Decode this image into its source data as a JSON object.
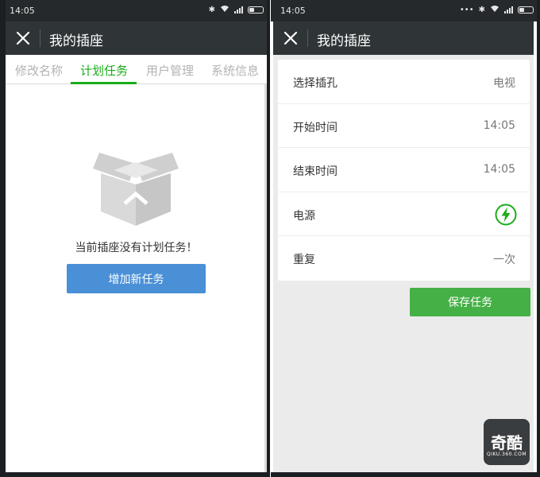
{
  "left": {
    "status": {
      "time": "14:05"
    },
    "header": {
      "title": "我的插座"
    },
    "tabs": [
      {
        "label": "修改名称",
        "active": false
      },
      {
        "label": "计划任务",
        "active": true
      },
      {
        "label": "用户管理",
        "active": false
      },
      {
        "label": "系统信息",
        "active": false
      }
    ],
    "empty": {
      "message": "当前插座没有计划任务！",
      "add_button": "增加新任务"
    }
  },
  "right": {
    "status": {
      "time": "14:05"
    },
    "header": {
      "title": "我的插座"
    },
    "rows": [
      {
        "label": "选择插孔",
        "value": "电视"
      },
      {
        "label": "开始时间",
        "value": "14:05"
      },
      {
        "label": "结束时间",
        "value": "14:05"
      },
      {
        "label": "电源",
        "value": "",
        "icon": "power-on-icon"
      },
      {
        "label": "重复",
        "value": "一次"
      }
    ],
    "save_button": "保存任务",
    "watermark": {
      "main": "奇酷",
      "sub": "QIKU.360.COM"
    }
  },
  "colors": {
    "accent_green": "#1aad19",
    "primary_blue": "#4a90d6",
    "save_green": "#45b046",
    "titlebar": "#2f3437"
  }
}
